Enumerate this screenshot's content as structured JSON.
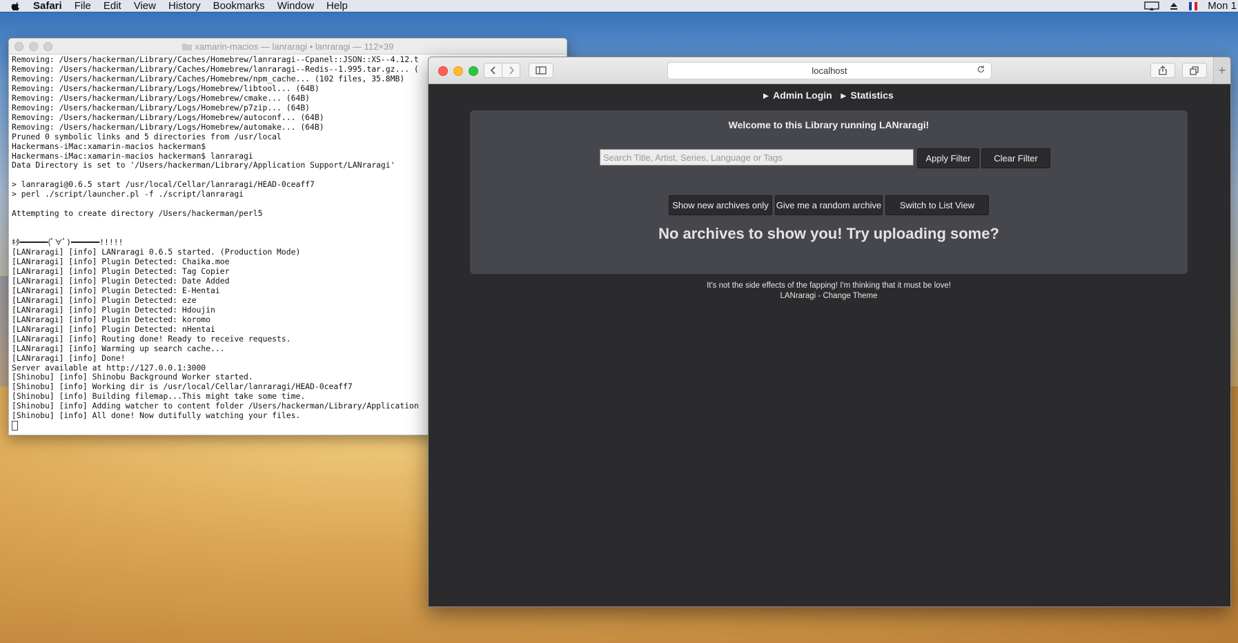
{
  "menubar": {
    "app": "Safari",
    "items": [
      "File",
      "Edit",
      "View",
      "History",
      "Bookmarks",
      "Window",
      "Help"
    ],
    "clock": "Mon 1"
  },
  "terminal": {
    "title": "xamarin-macios — lanraragi • lanraragi — 112×39",
    "lines": [
      "Removing: /Users/hackerman/Library/Caches/Homebrew/lanraragi--Cpanel::JSON::XS--4.12.t",
      "Removing: /Users/hackerman/Library/Caches/Homebrew/lanraragi--Redis--1.995.tar.gz... (",
      "Removing: /Users/hackerman/Library/Caches/Homebrew/npm_cache... (102 files, 35.8MB)",
      "Removing: /Users/hackerman/Library/Logs/Homebrew/libtool... (64B)",
      "Removing: /Users/hackerman/Library/Logs/Homebrew/cmake... (64B)",
      "Removing: /Users/hackerman/Library/Logs/Homebrew/p7zip... (64B)",
      "Removing: /Users/hackerman/Library/Logs/Homebrew/autoconf... (64B)",
      "Removing: /Users/hackerman/Library/Logs/Homebrew/automake... (64B)",
      "Pruned 0 symbolic links and 5 directories from /usr/local",
      "Hackermans-iMac:xamarin-macios hackerman$",
      "Hackermans-iMac:xamarin-macios hackerman$ lanraragi",
      "Data Directory is set to '/Users/hackerman/Library/Application Support/LANraragi'",
      "",
      "> lanraragi@0.6.5 start /usr/local/Cellar/lanraragi/HEAD-0ceaff7",
      "> perl ./script/launcher.pl -f ./script/lanraragi",
      "",
      "Attempting to create directory /Users/hackerman/perl5",
      "",
      "",
      "ｷﾀ━━━━━━(ﾟ∀ﾟ)━━━━━━!!!!!",
      "[LANraragi] [info] LANraragi 0.6.5 started. (Production Mode)",
      "[LANraragi] [info] Plugin Detected: Chaika.moe",
      "[LANraragi] [info] Plugin Detected: Tag Copier",
      "[LANraragi] [info] Plugin Detected: Date Added",
      "[LANraragi] [info] Plugin Detected: E-Hentai",
      "[LANraragi] [info] Plugin Detected: eze",
      "[LANraragi] [info] Plugin Detected: Hdoujin",
      "[LANraragi] [info] Plugin Detected: koromo",
      "[LANraragi] [info] Plugin Detected: nHentai",
      "[LANraragi] [info] Routing done! Ready to receive requests.",
      "[LANraragi] [info] Warming up search cache...",
      "[LANraragi] [info] Done!",
      "Server available at http://127.0.0.1:3000",
      "[Shinobu] [info] Shinobu Background Worker started.",
      "[Shinobu] [info] Working dir is /usr/local/Cellar/lanraragi/HEAD-0ceaff7",
      "[Shinobu] [info] Building filemap...This might take some time.",
      "[Shinobu] [info] Adding watcher to content folder /Users/hackerman/Library/Application",
      "[Shinobu] [info] All done! Now dutifully watching your files."
    ]
  },
  "safari": {
    "url": "localhost",
    "nav": [
      "Admin Login",
      "Statistics"
    ],
    "welcome": "Welcome to this Library running LANraragi!",
    "search_placeholder": "Search Title, Artist, Series, Language or Tags",
    "apply_filter": "Apply Filter",
    "clear_filter": "Clear Filter",
    "show_new": "Show new archives only",
    "random": "Give me a random archive",
    "list_view": "Switch to List View",
    "no_archives": "No archives to show you! Try uploading some?",
    "motd": "It's not the side effects of the fapping! I'm thinking that it must be love!",
    "footer_brand": "LANraragi",
    "footer_sep": " - ",
    "footer_theme": "Change Theme"
  }
}
